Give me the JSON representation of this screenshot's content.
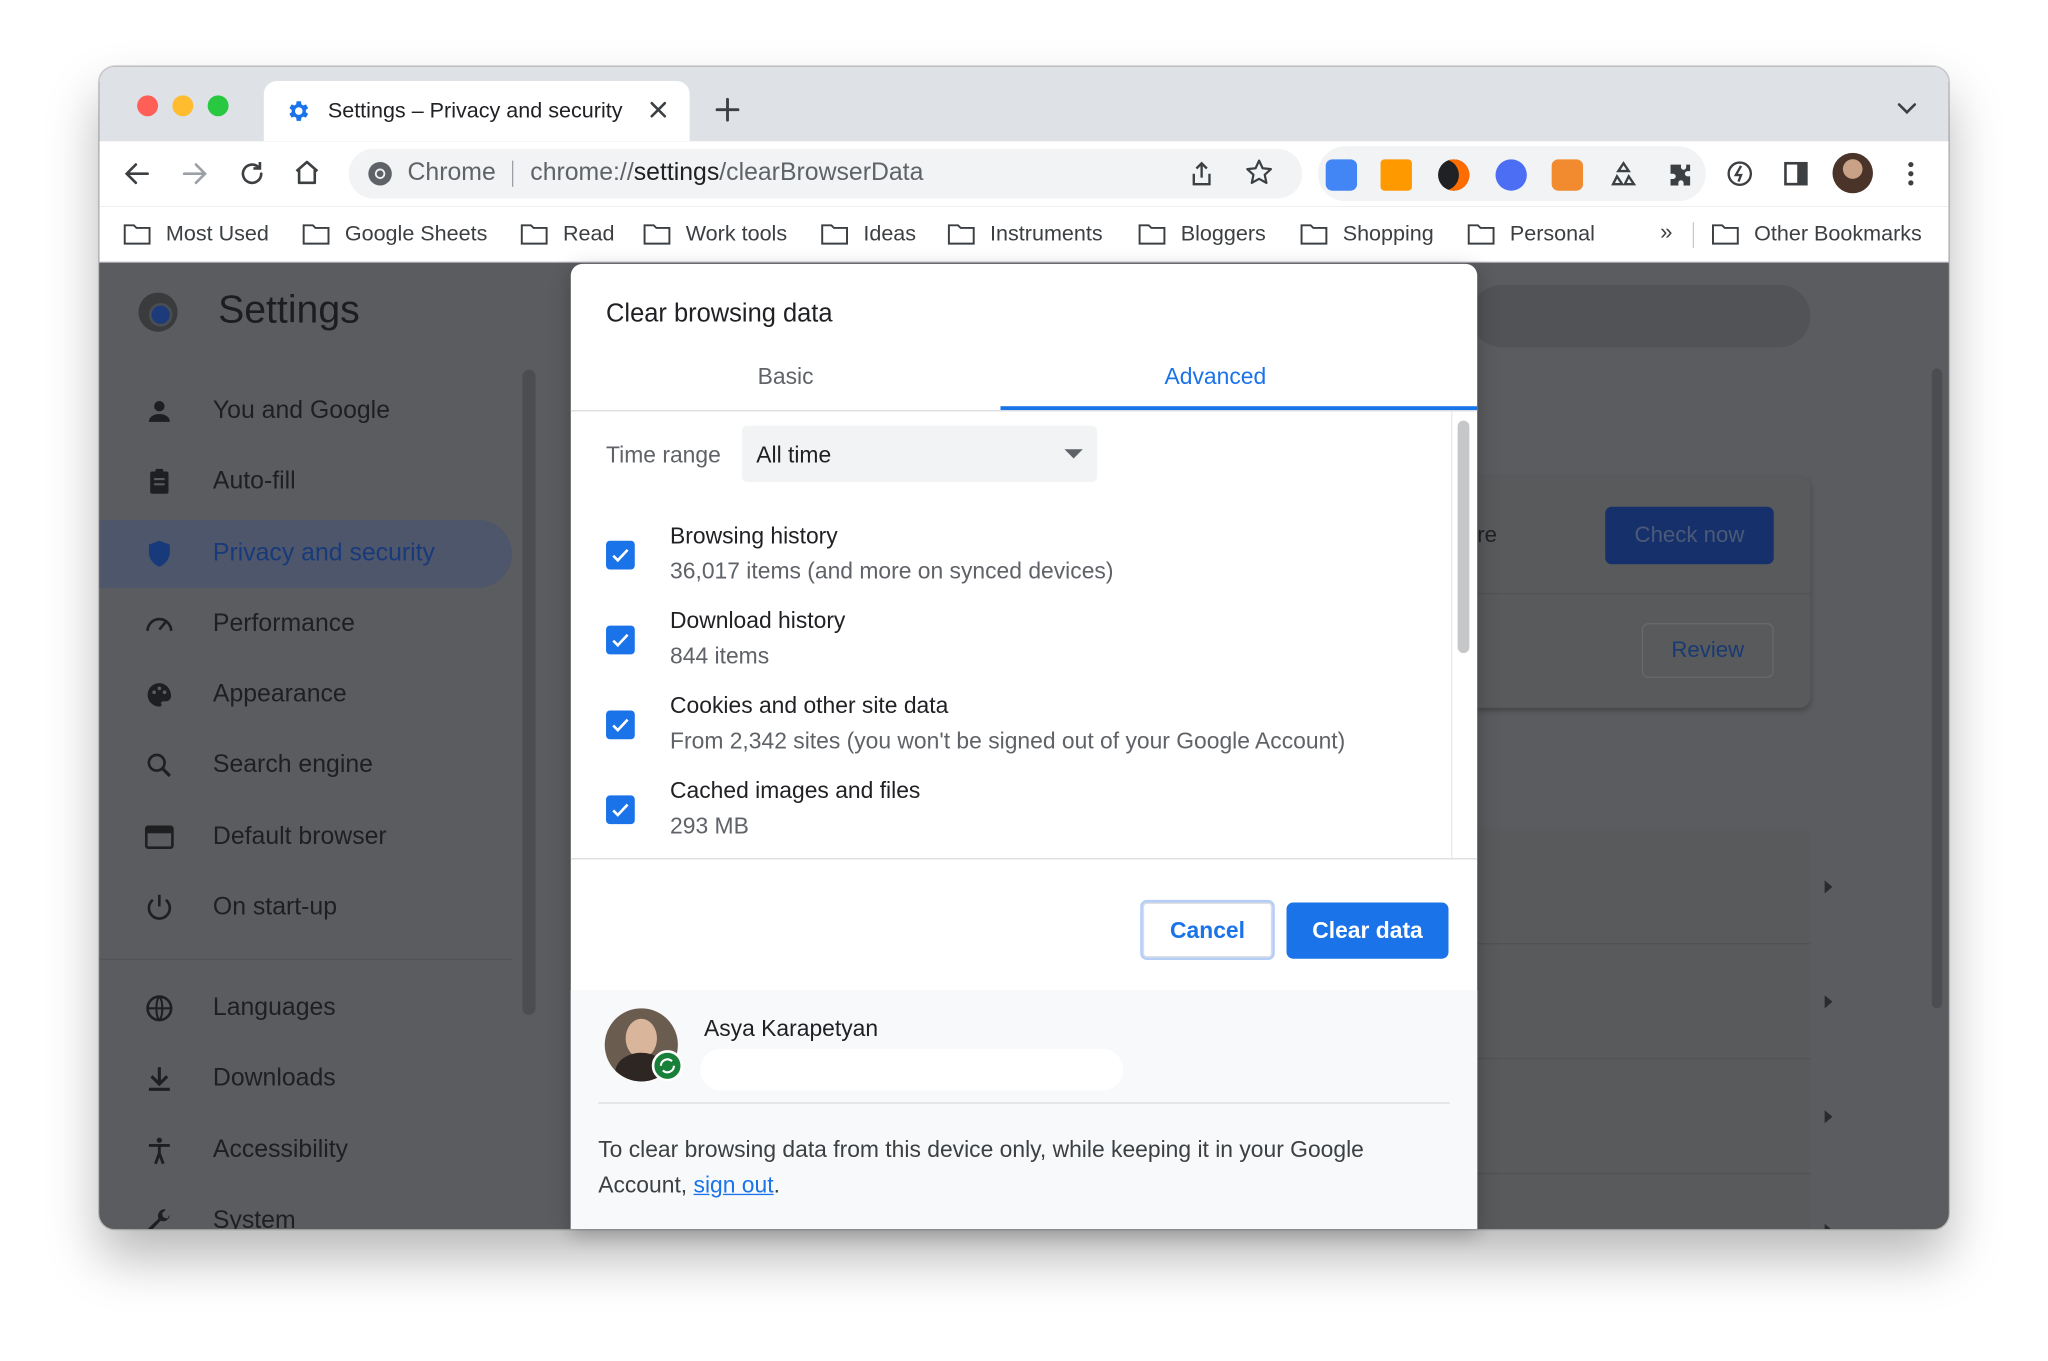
{
  "window": {
    "tab_title": "Settings – Privacy and security",
    "traffic_light_colors": [
      "#ff5f57",
      "#febc2e",
      "#28c840"
    ]
  },
  "toolbar": {
    "site_chip_label": "Chrome",
    "url_prefix": "chrome://",
    "url_host": "settings",
    "url_path": "/clearBrowserData",
    "extension_icons": [
      "google-translate-icon",
      "amazon-icon",
      "slice-icon",
      "a-circle-icon",
      "chart-icon",
      "recycle-icon",
      "puzzle-extensions-icon"
    ]
  },
  "bookmarks": {
    "items": [
      "Most Used",
      "Google Sheets",
      "Read",
      "Work tools",
      "Ideas",
      "Instruments",
      "Bloggers",
      "Shopping",
      "Personal"
    ],
    "more_label": "»",
    "other": "Other Bookmarks"
  },
  "settings": {
    "title": "Settings",
    "nav": [
      {
        "label": "You and Google",
        "icon": "person-icon"
      },
      {
        "label": "Auto-fill",
        "icon": "clipboard-icon"
      },
      {
        "label": "Privacy and security",
        "icon": "shield-icon",
        "active": true
      },
      {
        "label": "Performance",
        "icon": "speedometer-icon"
      },
      {
        "label": "Appearance",
        "icon": "palette-icon"
      },
      {
        "label": "Search engine",
        "icon": "search-icon"
      },
      {
        "label": "Default browser",
        "icon": "browser-icon"
      },
      {
        "label": "On start-up",
        "icon": "power-icon"
      },
      {
        "label": "Languages",
        "icon": "globe-icon"
      },
      {
        "label": "Downloads",
        "icon": "download-icon"
      },
      {
        "label": "Accessibility",
        "icon": "accessibility-icon"
      },
      {
        "label": "System",
        "icon": "wrench-icon"
      }
    ],
    "safety_check_partial": "re",
    "check_now": "Check now",
    "review": "Review"
  },
  "dialog": {
    "title": "Clear browsing data",
    "tabs": [
      "Basic",
      "Advanced"
    ],
    "active_tab": "Advanced",
    "time_range_label": "Time range",
    "time_range_value": "All time",
    "items": [
      {
        "title": "Browsing history",
        "subtitle": "36,017 items (and more on synced devices)",
        "checked": true
      },
      {
        "title": "Download history",
        "subtitle": "844 items",
        "checked": true
      },
      {
        "title": "Cookies and other site data",
        "subtitle": "From 2,342 sites (you won't be signed out of your Google Account)",
        "checked": true
      },
      {
        "title": "Cached images and files",
        "subtitle": "293 MB",
        "checked": true
      }
    ],
    "cancel": "Cancel",
    "clear": "Clear data",
    "account_name": "Asya Karapetyan",
    "footer_text": "To clear browsing data from this device only, while keeping it in your Google Account,",
    "footer_link": "sign out",
    "footer_end": ".",
    "accent_color": "#1a73e8"
  }
}
